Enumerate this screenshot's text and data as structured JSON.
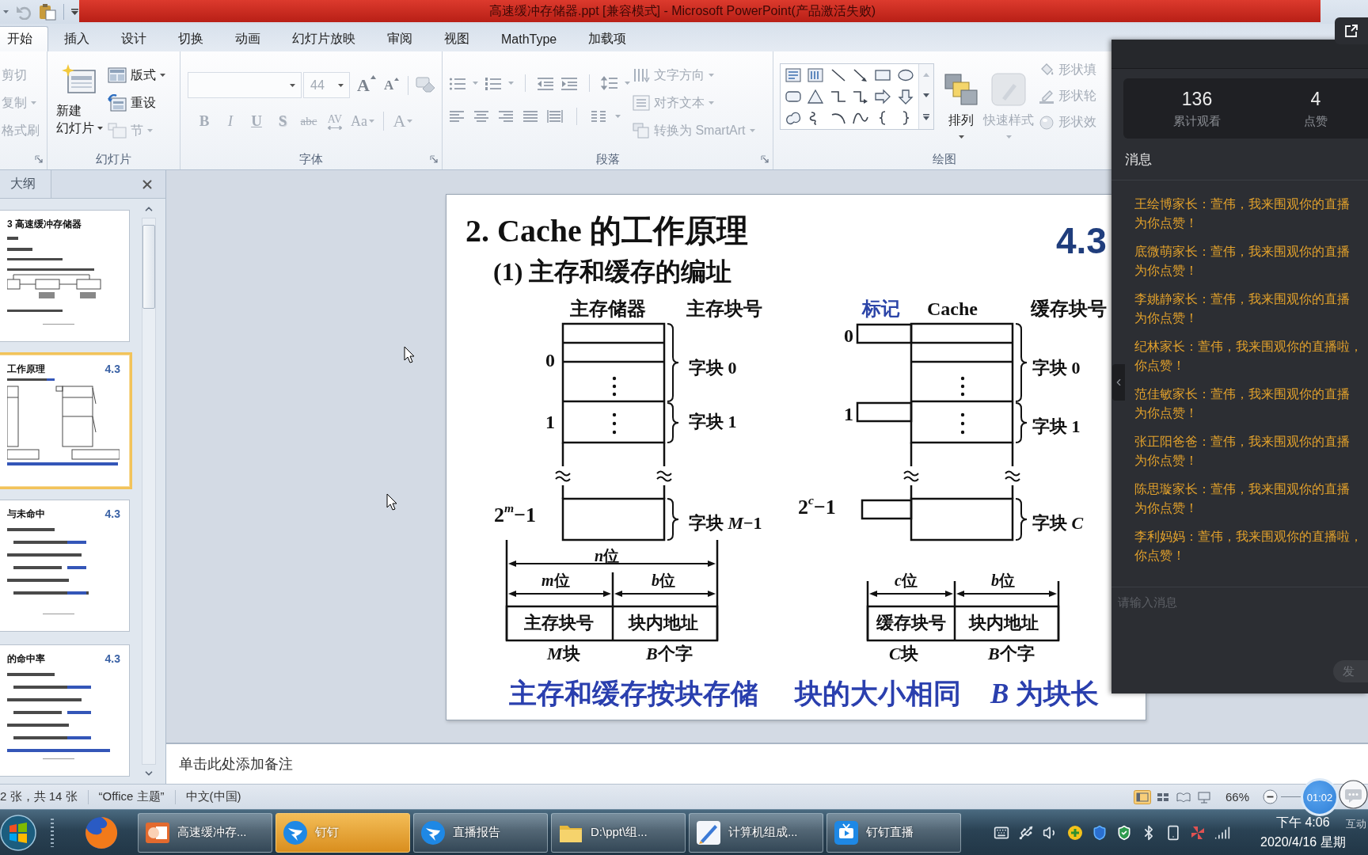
{
  "title_bar": {
    "title": "高速缓冲存储器.ppt [兼容模式] - Microsoft PowerPoint(产品激活失败)"
  },
  "ribbon_tabs": [
    {
      "label": "开始",
      "selected": true
    },
    {
      "label": "插入",
      "selected": false
    },
    {
      "label": "设计",
      "selected": false
    },
    {
      "label": "切换",
      "selected": false
    },
    {
      "label": "动画",
      "selected": false
    },
    {
      "label": "幻灯片放映",
      "selected": false
    },
    {
      "label": "审阅",
      "selected": false
    },
    {
      "label": "视图",
      "selected": false
    },
    {
      "label": "MathType",
      "selected": false
    },
    {
      "label": "加载项",
      "selected": false
    }
  ],
  "ribbon": {
    "clipboard": {
      "commands": [
        {
          "label": "剪切",
          "disabled": true,
          "dropdown": false
        },
        {
          "label": "复制",
          "disabled": true,
          "dropdown": true
        },
        {
          "label": "格式刷",
          "disabled": true,
          "dropdown": false
        }
      ]
    },
    "slides": {
      "label": "幻灯片",
      "new_slide": [
        "新建",
        "幻灯片"
      ],
      "commands": [
        {
          "label": "版式",
          "disabled": false,
          "dropdown": true
        },
        {
          "label": "重设",
          "disabled": false,
          "dropdown": false
        },
        {
          "label": "节",
          "disabled": true,
          "dropdown": true
        }
      ]
    },
    "font": {
      "label": "字体",
      "font_size": "44",
      "size_buttons": [
        {
          "kind": "grow",
          "label": "A",
          "disabled": false
        },
        {
          "kind": "shrink",
          "label": "A",
          "disabled": false
        }
      ],
      "format_buttons": [
        {
          "kind": "bold",
          "label": "B",
          "disabled": true
        },
        {
          "kind": "italic",
          "label": "I",
          "disabled": true
        },
        {
          "kind": "underline",
          "label": "U",
          "disabled": true
        },
        {
          "kind": "shadow",
          "label": "S",
          "disabled": true
        },
        {
          "kind": "strike",
          "label": "abc",
          "disabled": true
        },
        {
          "kind": "spacing",
          "label": "AV",
          "disabled": true
        },
        {
          "kind": "case",
          "label": "Aa",
          "disabled": true
        },
        {
          "kind": "color",
          "label": "A",
          "disabled": true
        }
      ]
    },
    "paragraph": {
      "label": "段落",
      "commands": [
        {
          "label": "文字方向",
          "disabled": true,
          "dropdown": true
        },
        {
          "label": "对齐文本",
          "disabled": true,
          "dropdown": true
        },
        {
          "label": "转换为 SmartArt",
          "disabled": true,
          "dropdown": true
        }
      ]
    },
    "drawing": {
      "label": "绘图",
      "arrange": {
        "label": "排列",
        "disabled": false
      },
      "quick_styles": {
        "label": "快速样式",
        "disabled": true
      },
      "shape_commands": [
        {
          "label": "形状填",
          "disabled": true
        },
        {
          "label": "形状轮",
          "disabled": true
        },
        {
          "label": "形状效",
          "disabled": true
        }
      ]
    }
  },
  "thumbnails": {
    "tab": "大纲",
    "slides": [
      {
        "title": "3 高速缓冲存储器",
        "selected": false
      },
      {
        "title": "工作原理",
        "section": "4.3",
        "selected": true
      },
      {
        "title": "与未命中",
        "section": "4.3",
        "selected": false
      },
      {
        "title": "的命中率",
        "section": "4.3",
        "selected": false
      }
    ]
  },
  "slide": {
    "title": "2. Cache 的工作原理",
    "section": "4.3",
    "subtitle": "(1) 主存和缓存的编址",
    "main_memory": {
      "heading": "主存储器",
      "number_heading": "主存块号",
      "row_labels": [
        "0",
        "1",
        "2$^{m}$−1"
      ],
      "blocks": [
        "字块 0",
        "字块 1",
        "字块 *M*−1"
      ],
      "total_width": "n位",
      "fields": [
        {
          "width": "m位",
          "name": "主存块号",
          "unit": "M块"
        },
        {
          "width": "b位",
          "name": "块内地址",
          "unit": "B个字"
        }
      ]
    },
    "cache": {
      "tag_heading": "标记",
      "heading": "Cache",
      "number_heading": "缓存块号",
      "row_labels": [
        "0",
        "1",
        "2$^{c}$−1"
      ],
      "blocks": [
        "字块 0",
        "字块 1",
        "字块 *C*"
      ],
      "fields": [
        {
          "width": "c位",
          "name": "缓存块号",
          "unit": "C块"
        },
        {
          "width": "b位",
          "name": "块内地址",
          "unit": "B个字"
        }
      ]
    },
    "summary": [
      "主存和缓存按块存储",
      "块的大小相同",
      "*B* 为块长"
    ]
  },
  "notes": {
    "placeholder": "单击此处添加备注"
  },
  "live_panel": {
    "stats": [
      {
        "value": "136",
        "label": "累计观看"
      },
      {
        "value": "4",
        "label": "点赞"
      }
    ],
    "messages_title": "消息",
    "messages": [
      {
        "lines": [
          "王绘博家长：萱伟，我来围观你的直播",
          "为你点赞！"
        ]
      },
      {
        "lines": [
          "底微萌家长：萱伟，我来围观你的直播",
          "为你点赞！"
        ]
      },
      {
        "lines": [
          "李姚静家长：萱伟，我来围观你的直播",
          "为你点赞！"
        ]
      },
      {
        "lines": [
          "纪林家长：萱伟，我来围观你的直播啦，",
          "你点赞！"
        ]
      },
      {
        "lines": [
          "范佳敏家长：萱伟，我来围观你的直播",
          "为你点赞！"
        ]
      },
      {
        "lines": [
          "张正阳爸爸：萱伟，我来围观你的直播",
          "为你点赞！"
        ]
      },
      {
        "lines": [
          "陈思璇家长：萱伟，我来围观你的直播",
          "为你点赞！"
        ]
      },
      {
        "lines": [
          "李利妈妈：萱伟，我来围观你的直播啦，",
          "你点赞！"
        ]
      }
    ],
    "input": {
      "placeholder": "请输入消息"
    },
    "send_button": "发"
  },
  "status_bar": {
    "slide_info": "2 张，共 14 张",
    "theme": "“Office 主题”",
    "language": "中文(中国)",
    "view_buttons": [
      {
        "selected": true
      },
      {
        "selected": false
      },
      {
        "selected": false
      },
      {
        "selected": false
      }
    ],
    "zoom": "66%"
  },
  "recording_timer": "01:02",
  "taskbar": {
    "buttons": [
      {
        "label": "高速缓冲存...",
        "highlighted": false
      },
      {
        "label": "钉钉",
        "highlighted": true
      },
      {
        "label": "直播报告",
        "highlighted": false
      },
      {
        "label": "D:\\ppt\\组...",
        "highlighted": false
      },
      {
        "label": "计算机组成...",
        "highlighted": false
      },
      {
        "label": "钉钉直播",
        "highlighted": false
      }
    ],
    "clock": {
      "time": "下午 4:06",
      "date": "2020/4/16 星期"
    }
  },
  "overlay_label": "互动"
}
